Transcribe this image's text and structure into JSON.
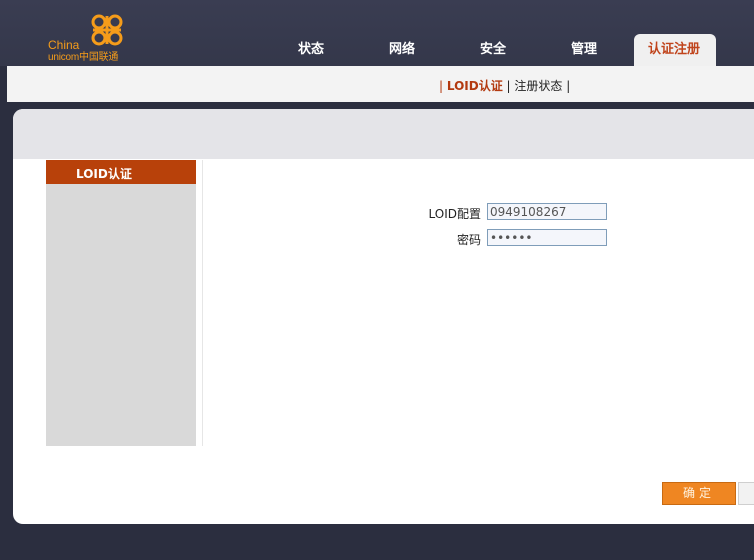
{
  "brand": {
    "line1": "China",
    "line2": "unicom中国联通",
    "color": "#f59c1a"
  },
  "nav": {
    "items": [
      {
        "label": "状态"
      },
      {
        "label": "网络"
      },
      {
        "label": "安全"
      },
      {
        "label": "管理"
      }
    ],
    "active_label": "认证注册"
  },
  "subnav": {
    "sep1": "| ",
    "active": "LOID认证",
    "sep2": " | ",
    "other": "注册状态",
    "sep3": " |"
  },
  "sidebar": {
    "active_item": "LOID认证"
  },
  "form": {
    "loid_label": "LOID配置",
    "loid_value": "0949108267",
    "password_label": "密码",
    "password_value": "••••••"
  },
  "buttons": {
    "ok_label": "确定"
  },
  "colors": {
    "accent": "#b8410a",
    "button": "#ef8622",
    "header": "#3a3d52"
  }
}
